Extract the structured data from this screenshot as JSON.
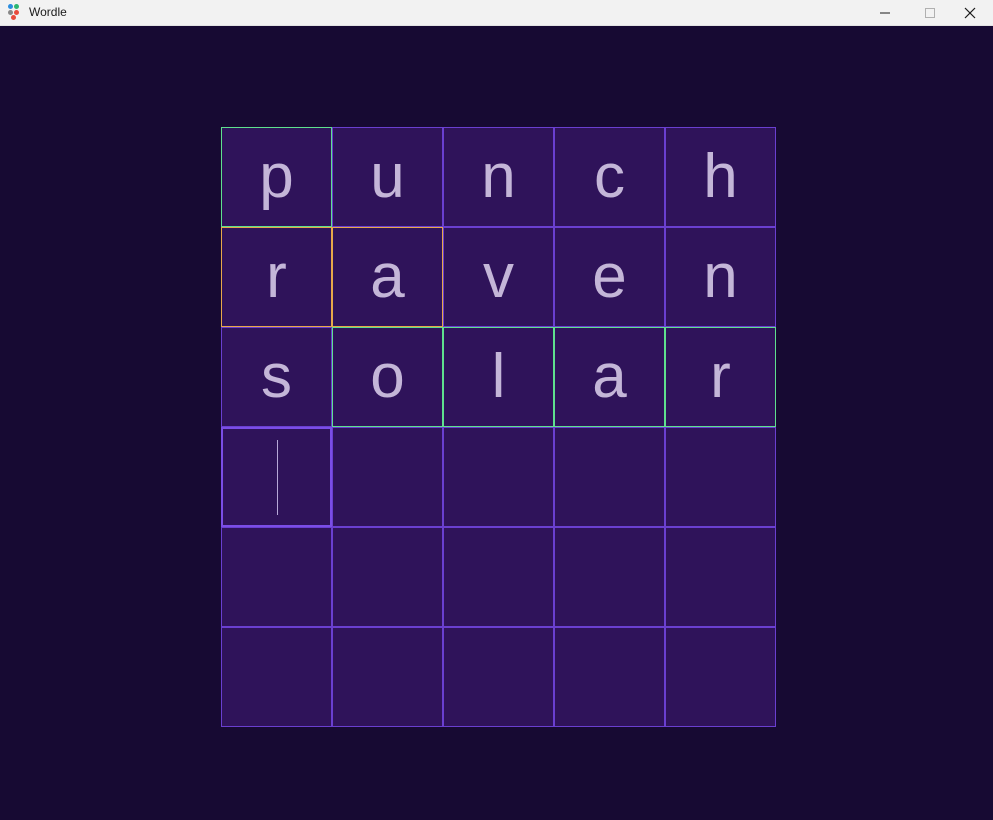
{
  "window": {
    "title": "Wordle",
    "icon": "wordle-app-icon",
    "controls": [
      "minimize-icon",
      "maximize-icon",
      "close-icon"
    ]
  },
  "board": {
    "rows": [
      {
        "letters": [
          "p",
          "u",
          "n",
          "c",
          "h"
        ],
        "states": [
          "correct",
          "none",
          "none",
          "none",
          "none"
        ]
      },
      {
        "letters": [
          "r",
          "a",
          "v",
          "e",
          "n"
        ],
        "states": [
          "present",
          "present",
          "none",
          "none",
          "none"
        ]
      },
      {
        "letters": [
          "s",
          "o",
          "l",
          "a",
          "r"
        ],
        "states": [
          "none",
          "correct",
          "correct",
          "correct",
          "correct"
        ]
      },
      {
        "letters": [
          "",
          "",
          "",
          "",
          ""
        ],
        "states": [
          "active",
          "none",
          "none",
          "none",
          "none"
        ]
      },
      {
        "letters": [
          "",
          "",
          "",
          "",
          ""
        ],
        "states": [
          "none",
          "none",
          "none",
          "none",
          "none"
        ]
      },
      {
        "letters": [
          "",
          "",
          "",
          "",
          ""
        ],
        "states": [
          "none",
          "none",
          "none",
          "none",
          "none"
        ]
      }
    ]
  },
  "colors": {
    "background": "#170a33",
    "tile_fill": "#2f135a",
    "tile_border": "#6a3fd0",
    "correct_border": "#5fe08e",
    "present_border": "#e8a84a",
    "letter": "#c4b6d8"
  }
}
